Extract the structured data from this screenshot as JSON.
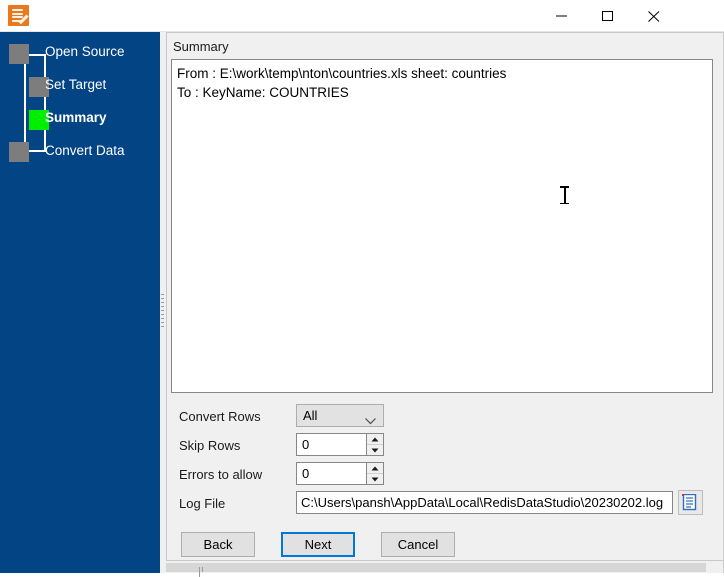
{
  "window": {
    "title": "",
    "app_icon": "database-pencil-icon",
    "controls": {
      "minimize": "minimize-icon",
      "maximize": "maximize-icon",
      "close": "close-icon"
    }
  },
  "sidebar": {
    "steps": [
      {
        "label": "Open Source",
        "state": "pending"
      },
      {
        "label": "Set Target",
        "state": "pending"
      },
      {
        "label": "Summary",
        "state": "current"
      },
      {
        "label": "Convert Data",
        "state": "pending"
      }
    ],
    "colors": {
      "background": "#034485",
      "pending_marker": "#7d7d7d",
      "current_marker": "#00ef00",
      "connector": "#ffffff"
    }
  },
  "main": {
    "group_label": "Summary",
    "summary_lines": [
      "From : E:\\work\\temp\\nton\\countries.xls sheet: countries",
      "To : KeyName: COUNTRIES"
    ],
    "form": {
      "convert_rows": {
        "label": "Convert Rows",
        "value": "All",
        "options": [
          "All"
        ]
      },
      "skip_rows": {
        "label": "Skip Rows",
        "value": "0"
      },
      "errors_to_allow": {
        "label": "Errors to allow",
        "value": "0"
      },
      "log_file": {
        "label": "Log File",
        "value": "C:\\Users\\pansh\\AppData\\Local\\RedisDataStudio\\20230202.log",
        "browse_icon": "document-icon"
      }
    },
    "buttons": {
      "back": "Back",
      "next": "Next",
      "cancel": "Cancel",
      "default_button": "Next",
      "focus_color": "#0078d7"
    }
  }
}
